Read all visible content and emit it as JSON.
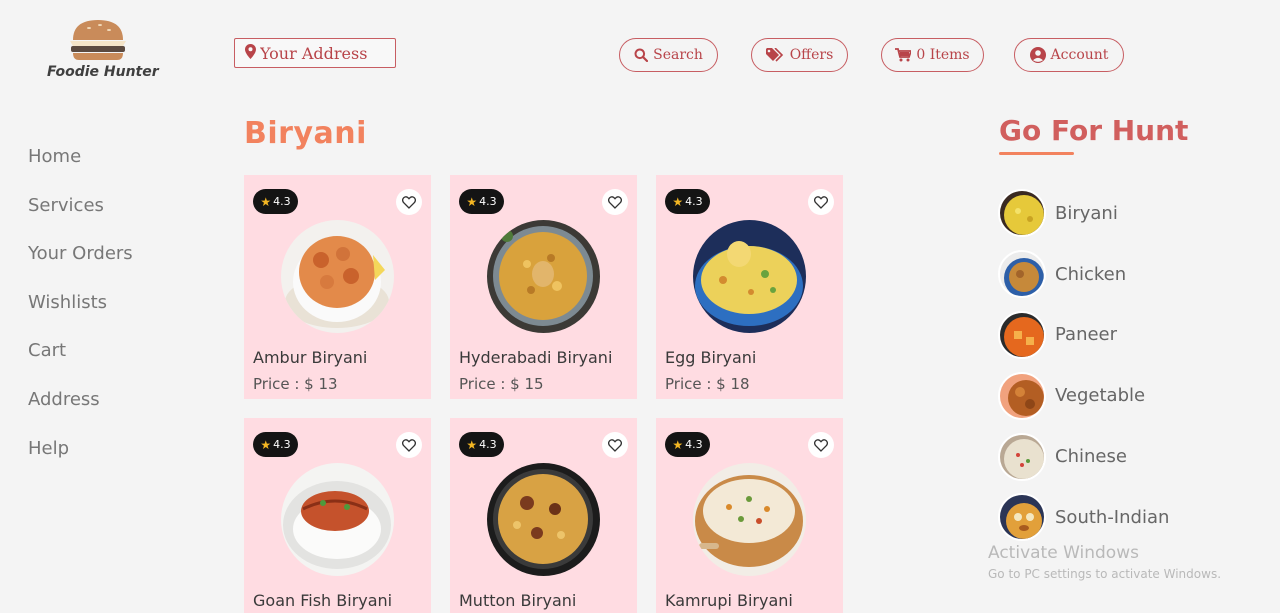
{
  "brand": {
    "name": "Foodie Hunter"
  },
  "header": {
    "address_placeholder": "Your Address",
    "buttons": {
      "search": "Search",
      "offers": "Offers",
      "cart": "0 Items",
      "account": "Account"
    }
  },
  "sidebar": {
    "items": [
      "Home",
      "Services",
      "Your Orders",
      "Wishlists",
      "Cart",
      "Address",
      "Help"
    ]
  },
  "main": {
    "title": "Biryani",
    "cards": [
      {
        "rating": "4.3",
        "name": "Ambur Biryani",
        "price": "Price : $ 13"
      },
      {
        "rating": "4.3",
        "name": "Hyderabadi Biryani",
        "price": "Price : $ 15"
      },
      {
        "rating": "4.3",
        "name": "Egg Biryani",
        "price": "Price : $ 18"
      },
      {
        "rating": "4.3",
        "name": "Goan Fish Biryani",
        "price": ""
      },
      {
        "rating": "4.3",
        "name": "Mutton Biryani",
        "price": ""
      },
      {
        "rating": "4.3",
        "name": "Kamrupi Biryani",
        "price": ""
      }
    ]
  },
  "hunt": {
    "title": "Go For Hunt",
    "items": [
      "Biryani",
      "Chicken",
      "Paneer",
      "Vegetable",
      "Chinese",
      "South-Indian"
    ]
  },
  "watermark": {
    "title": "Activate Windows",
    "subtitle": "Go to PC settings to activate Windows."
  },
  "colors": {
    "accent": "#c75d62",
    "title": "#f2825e",
    "card_bg": "#ffdce2"
  }
}
